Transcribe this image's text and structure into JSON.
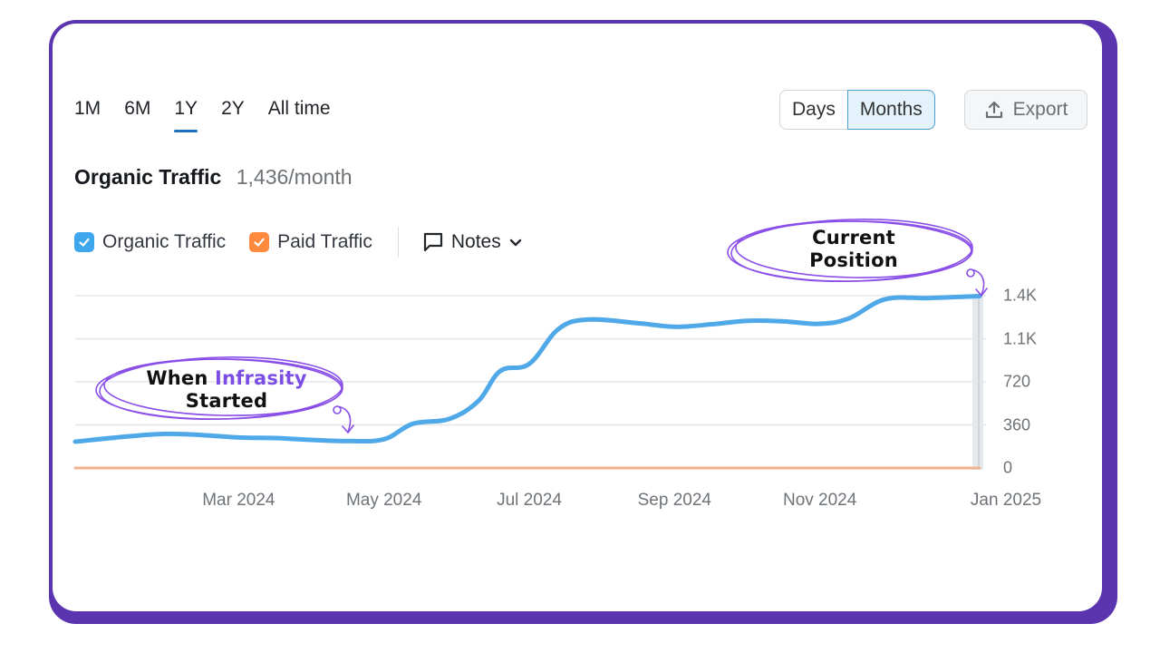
{
  "range_tabs": [
    {
      "label": "1M",
      "active": false
    },
    {
      "label": "6M",
      "active": false
    },
    {
      "label": "1Y",
      "active": true
    },
    {
      "label": "2Y",
      "active": false
    },
    {
      "label": "All time",
      "active": false
    }
  ],
  "granularity": {
    "days_label": "Days",
    "months_label": "Months",
    "selected": "Months"
  },
  "export": {
    "label": "Export",
    "icon": "upload-icon"
  },
  "header": {
    "metric_name": "Organic Traffic",
    "metric_value": "1,436/month"
  },
  "legend": {
    "items": [
      {
        "label": "Organic Traffic",
        "checked": true,
        "color": "#3ea6ec"
      },
      {
        "label": "Paid Traffic",
        "checked": true,
        "color": "#ff8a3d"
      }
    ],
    "notes_label": "Notes",
    "notes_icon": "comment-icon"
  },
  "annotations": {
    "start": {
      "line1_a": "When ",
      "line1_b": "Infrasity",
      "line2": "Started"
    },
    "current": {
      "line1": "Current",
      "line2": "Position"
    }
  },
  "colors": {
    "frame": "#5b34b0",
    "organic": "#4fa8e8",
    "paid": "#f0b28f",
    "annotation": "#8a4fe8",
    "highlight": "#7c4ee4"
  },
  "chart_data": {
    "type": "line",
    "title": "Organic Traffic",
    "xlabel": "",
    "ylabel": "",
    "x": [
      0,
      0.5,
      1,
      1.5,
      2,
      2.5,
      3,
      3.5,
      4,
      4.5,
      5,
      5.5,
      6,
      6.5,
      7,
      7.5,
      8,
      8.5,
      9,
      9.5,
      10,
      10.5,
      11,
      11.2
    ],
    "x_ticks": [
      {
        "pos": 1,
        "label": "Mar 2024"
      },
      {
        "pos": 3,
        "label": "May 2024"
      },
      {
        "pos": 5,
        "label": "Jul 2024"
      },
      {
        "pos": 7,
        "label": "Sep 2024"
      },
      {
        "pos": 9,
        "label": "Nov 2024"
      },
      {
        "pos": 11.1,
        "label": "Jan 2025"
      }
    ],
    "y_ticks": [
      {
        "value": 0,
        "label": "0"
      },
      {
        "value": 360,
        "label": "360"
      },
      {
        "value": 720,
        "label": "720"
      },
      {
        "value": 1080,
        "label": "1.1K"
      },
      {
        "value": 1440,
        "label": "1.4K"
      }
    ],
    "ylim": [
      0,
      1440
    ],
    "xlim": [
      -1.25,
      11.2
    ],
    "series": [
      {
        "name": "Organic Traffic",
        "color": "#4fa8e8",
        "points": [
          [
            -1.25,
            220
          ],
          [
            -0.5,
            265
          ],
          [
            0,
            285
          ],
          [
            0.5,
            275
          ],
          [
            1,
            255
          ],
          [
            1.5,
            250
          ],
          [
            2,
            235
          ],
          [
            2.5,
            225
          ],
          [
            3,
            240
          ],
          [
            3.4,
            370
          ],
          [
            3.9,
            410
          ],
          [
            4.3,
            560
          ],
          [
            4.6,
            810
          ],
          [
            5.0,
            870
          ],
          [
            5.4,
            1160
          ],
          [
            5.8,
            1240
          ],
          [
            6.5,
            1210
          ],
          [
            7,
            1180
          ],
          [
            7.5,
            1200
          ],
          [
            8,
            1230
          ],
          [
            8.5,
            1225
          ],
          [
            9,
            1205
          ],
          [
            9.4,
            1250
          ],
          [
            9.9,
            1410
          ],
          [
            10.5,
            1420
          ],
          [
            11.2,
            1436
          ]
        ]
      },
      {
        "name": "Paid Traffic",
        "color": "#f0b28f",
        "points": [
          [
            -1.25,
            0
          ],
          [
            11.2,
            0
          ]
        ]
      }
    ],
    "grid": true,
    "legend_position": "top-left"
  }
}
